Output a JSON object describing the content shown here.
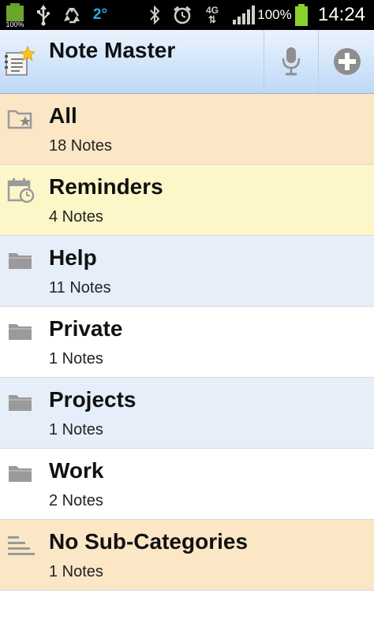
{
  "status_bar": {
    "battery_small_label": "100%",
    "temperature": "2°",
    "network": "4G",
    "battery_percent": "100%",
    "time": "14:24"
  },
  "action_bar": {
    "title": "Note Master",
    "app_icon": "notebook-star-icon",
    "voice_icon": "microphone-icon",
    "add_icon": "plus-circle-icon"
  },
  "categories": [
    {
      "title": "All",
      "count": "18 Notes",
      "icon": "folder-star-icon",
      "background": "#fbe6c5"
    },
    {
      "title": "Reminders",
      "count": "4 Notes",
      "icon": "calendar-clock-icon",
      "background": "#fdf6c8"
    },
    {
      "title": "Help",
      "count": "11 Notes",
      "icon": "folder-icon",
      "background": "#e6eefa"
    },
    {
      "title": "Private",
      "count": "1 Notes",
      "icon": "folder-icon",
      "background": "#ffffff"
    },
    {
      "title": "Projects",
      "count": "1 Notes",
      "icon": "folder-icon",
      "background": "#e6eefa"
    },
    {
      "title": "Work",
      "count": "2 Notes",
      "icon": "folder-icon",
      "background": "#ffffff"
    },
    {
      "title": "No Sub-Categories",
      "count": "1 Notes",
      "icon": "lines-icon",
      "background": "#fbe6c5"
    }
  ]
}
